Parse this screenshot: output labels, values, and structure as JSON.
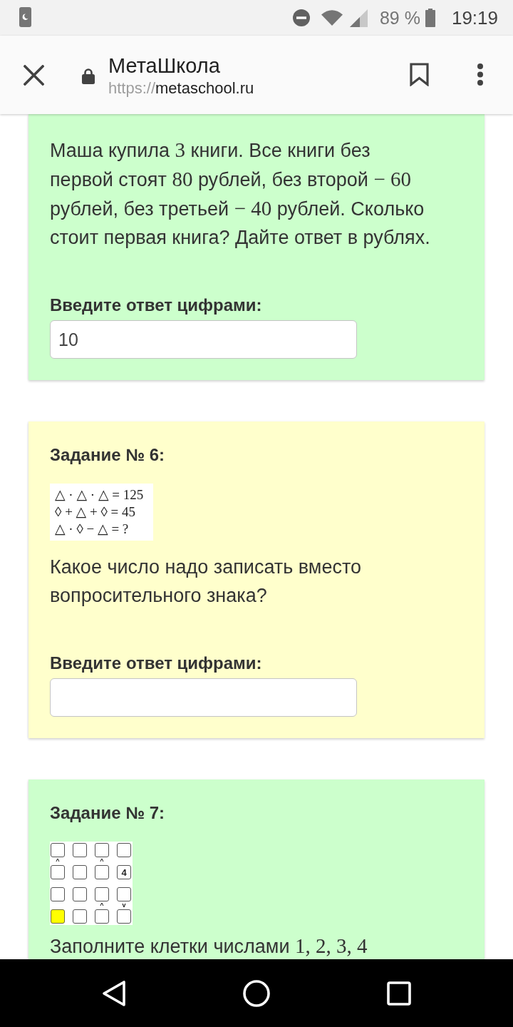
{
  "status_bar": {
    "battery": "89 %",
    "time": "19:19"
  },
  "toolbar": {
    "title": "МетаШкола",
    "url": {
      "scheme": "https://",
      "host": "metaschool.ru"
    }
  },
  "tasks": [
    {
      "color": "#ccffcc",
      "text": [
        {
          "kind": "text",
          "text": "Маша купила "
        },
        {
          "kind": "math",
          "text": "3"
        },
        {
          "kind": "text",
          "text": " книги. Все книги без\nпервой стоят "
        },
        {
          "kind": "math",
          "text": "80"
        },
        {
          "kind": "text",
          "text": " рублей, без второй "
        },
        {
          "kind": "math",
          "text": "− 60"
        },
        {
          "kind": "text",
          "text": "\nрублей, без третьей "
        },
        {
          "kind": "math",
          "text": "− 40"
        },
        {
          "kind": "text",
          "text": " рублей. Сколько\nстоит первая книга? Дайте ответ в рублях."
        }
      ],
      "answer": {
        "label": "Введите ответ цифрами:",
        "value": "10"
      }
    },
    {
      "color": "#ffffcc",
      "title": "Задание № 6:",
      "figure": {
        "kind": "formula",
        "lines": [
          "△ · △ · △ = 125",
          "◊ + △ + ◊ = 45",
          "△ · ◊ − △ = ?"
        ]
      },
      "text": [
        {
          "kind": "text",
          "text": "Какое число надо записать вместо вопросительного знака?"
        }
      ],
      "answer": {
        "label": "Введите ответ цифрами:"
      }
    },
    {
      "color": "#ccffcc",
      "title": "Задание № 7:",
      "figure": {
        "kind": "grid",
        "rows": [
          [
            {
              "highlighted": false,
              "sign_below": "^"
            },
            {
              "highlighted": false
            },
            {
              "highlighted": false,
              "sign_below": "^"
            },
            {
              "highlighted": false
            }
          ],
          [
            {
              "highlighted": false
            },
            {
              "highlighted": false
            },
            {
              "highlighted": false
            },
            {
              "highlighted": false,
              "value": "4"
            }
          ],
          [
            {
              "highlighted": false
            },
            {
              "highlighted": false
            },
            {
              "highlighted": false,
              "sign_below": "^"
            },
            {
              "highlighted": false,
              "sign_below": "v"
            }
          ],
          [
            {
              "highlighted": true
            },
            {
              "highlighted": false
            },
            {
              "highlighted": false
            },
            {
              "highlighted": false
            }
          ]
        ]
      },
      "text": [
        {
          "kind": "text",
          "text": "Заполните клетки числами "
        },
        {
          "kind": "math",
          "text": "1, 2, 3, 4"
        }
      ]
    }
  ]
}
